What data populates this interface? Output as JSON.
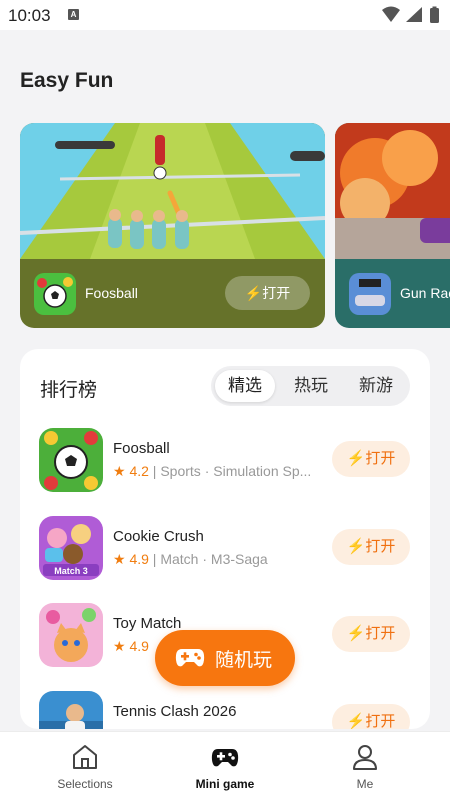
{
  "status_bar": {
    "time": "10:03",
    "a_badge": "A"
  },
  "page_title": "Easy Fun",
  "banners": [
    {
      "name": "Foosball",
      "open_label": "打开"
    },
    {
      "name": "Gun Rac"
    }
  ],
  "ranking": {
    "title": "排行榜",
    "tabs": [
      "精选",
      "热玩",
      "新游"
    ],
    "items": [
      {
        "name": "Foosball",
        "rating": "4.2",
        "tags": "Sports · Simulation Sp...",
        "open_label": "打开"
      },
      {
        "name": "Cookie Crush",
        "rating": "4.9",
        "tags": "Match · M3-Saga",
        "open_label": "打开",
        "icon_text": "Match 3"
      },
      {
        "name": "Toy Match",
        "rating": "4.9",
        "tags": "",
        "open_label": "打开"
      },
      {
        "name": "Tennis Clash 2026",
        "open_label": "打开"
      }
    ]
  },
  "fab": {
    "label": "随机玩"
  },
  "bottom_nav": [
    {
      "label": "Selections",
      "icon": "home-icon"
    },
    {
      "label": "Mini game",
      "icon": "gamepad-icon",
      "active": true
    },
    {
      "label": "Me",
      "icon": "user-icon"
    }
  ],
  "colors": {
    "accent": "#f7760f",
    "open_bg": "#fdeee0",
    "banner1": "#66722a",
    "banner2": "#2a6e68"
  }
}
